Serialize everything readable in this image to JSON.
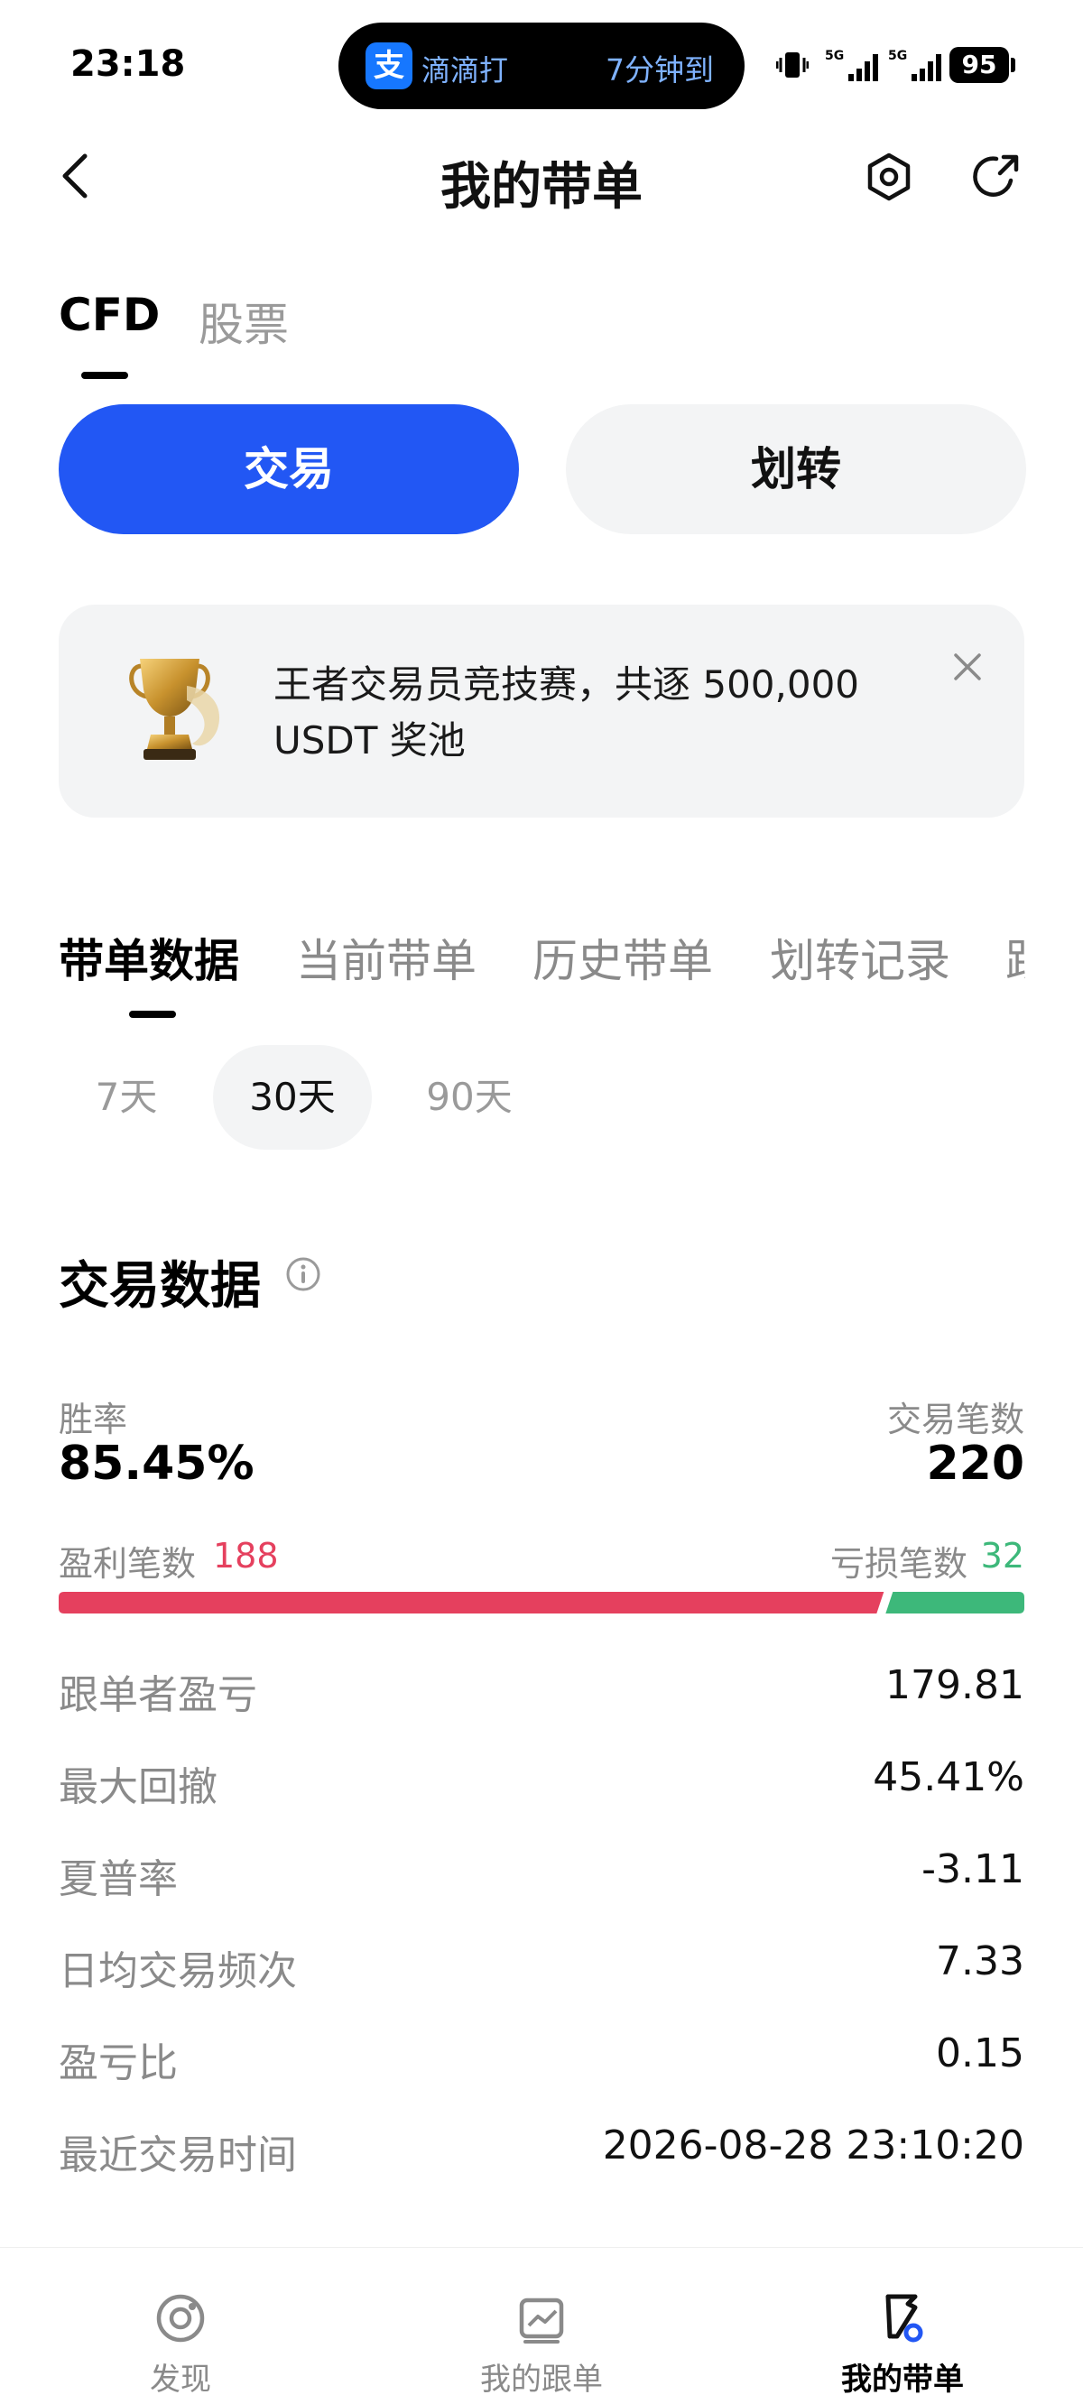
{
  "status_bar": {
    "time": "23:18",
    "live_activity_app_icon": "支",
    "live_activity_left": "滴滴打",
    "live_activity_right": "7分钟到",
    "battery": "95"
  },
  "header": {
    "title": "我的带单",
    "icons": [
      "back-icon",
      "settings-icon",
      "share-icon"
    ]
  },
  "market_tabs": [
    {
      "label": "CFD",
      "active": true
    },
    {
      "label": "股票",
      "active": false
    }
  ],
  "actions": {
    "trade_label": "交易",
    "transfer_label": "划转"
  },
  "banner": {
    "text": "王者交易员竞技赛，共逐 500,000 USDT 奖池"
  },
  "section_tabs": [
    {
      "label": "带单数据",
      "active": true
    },
    {
      "label": "当前带单",
      "active": false
    },
    {
      "label": "历史带单",
      "active": false
    },
    {
      "label": "划转记录",
      "active": false
    },
    {
      "label": "跟",
      "active": false
    }
  ],
  "periods": [
    {
      "label": "7天",
      "active": false
    },
    {
      "label": "30天",
      "active": true
    },
    {
      "label": "90天",
      "active": false
    }
  ],
  "trading_data": {
    "title": "交易数据",
    "win_rate_label": "胜率",
    "win_rate": "85.45%",
    "trade_count_label": "交易笔数",
    "trade_count": "220",
    "profit_count_label": "盈利笔数",
    "profit_count": "188",
    "loss_count_label": "亏损笔数",
    "loss_count": "32",
    "profit_fraction": 0.8545,
    "colors": {
      "profit": "#e5405e",
      "loss": "#3db87a",
      "accent": "#2257f4"
    },
    "rows": [
      {
        "label": "跟单者盈亏",
        "value": "179.81"
      },
      {
        "label": "最大回撤",
        "value": "45.41%"
      },
      {
        "label": "夏普率",
        "value": "-3.11"
      },
      {
        "label": "日均交易频次",
        "value": "7.33"
      },
      {
        "label": "盈亏比",
        "value": "0.15"
      },
      {
        "label": "最近交易时间",
        "value": "2026-08-28 23:10:20"
      }
    ]
  },
  "bottom_nav": [
    {
      "label": "发现",
      "icon": "discover-icon",
      "active": false
    },
    {
      "label": "我的跟单",
      "icon": "copy-trade-icon",
      "active": false
    },
    {
      "label": "我的带单",
      "icon": "lead-trade-icon",
      "active": true
    }
  ]
}
